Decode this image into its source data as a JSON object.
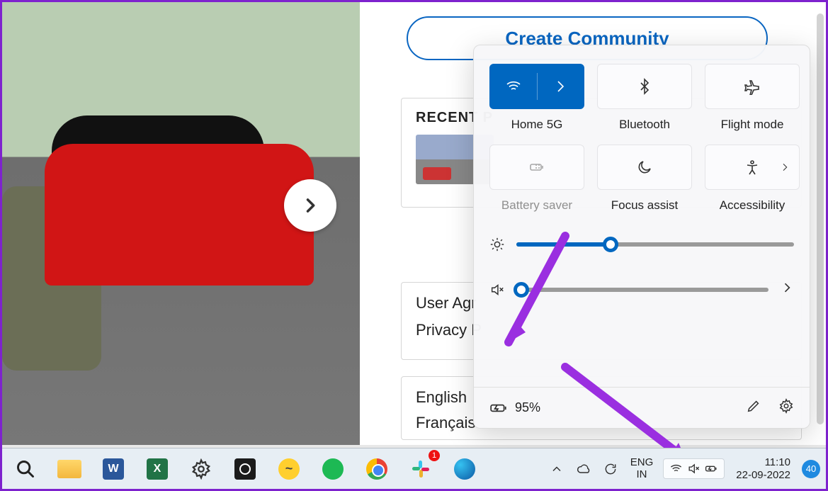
{
  "browser": {
    "create_community_label": "Create Community",
    "recent_header": "RECENT P",
    "user_agreement": "User Agr",
    "privacy": "Privacy P",
    "lang1": "English",
    "lang2": "Français"
  },
  "quick_settings": {
    "tiles": {
      "wifi": {
        "label": "Home 5G"
      },
      "bluetooth": {
        "label": "Bluetooth"
      },
      "flight_mode": {
        "label": "Flight mode"
      },
      "battery_saver": {
        "label": "Battery saver"
      },
      "focus_assist": {
        "label": "Focus assist"
      },
      "accessibility": {
        "label": "Accessibility"
      }
    },
    "brightness_pct": 34,
    "volume_pct": 2,
    "battery_text": "95%"
  },
  "taskbar": {
    "lang_top": "ENG",
    "lang_bottom": "IN",
    "time": "11:10",
    "date": "22-09-2022",
    "notif_count": "40",
    "slack_badge": "1"
  }
}
